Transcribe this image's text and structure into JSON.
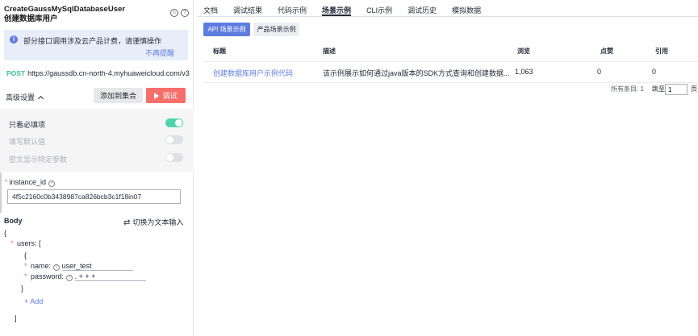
{
  "left": {
    "title": "CreateGaussMySqlDatabaseUser",
    "subtitle": "创建数据库用户",
    "notice_text": "部分接口调用涉及云产品计费，请谨慎操作",
    "notice_dismiss": "不再提醒",
    "method": "POST",
    "url": "https://gaussdb.cn-north-4.myhuaweicloud.com/v3...",
    "advanced_label": "高级设置",
    "add_to_collection": "添加到集合",
    "debug": "调试",
    "options": [
      {
        "label": "只看必填项",
        "state": "on"
      },
      {
        "label": "填写默认值",
        "state": "off"
      },
      {
        "label": "密文显示特定参数",
        "state": "off"
      }
    ],
    "instance_label": "instance_id",
    "instance_value": "4f5c2160c0b3438987ca826bcb3c1f18in07",
    "body_label": "Body",
    "switch_text": "切换为文本输入",
    "code": {
      "open_brace": "{",
      "users_key": "users: [",
      "item_open": "{",
      "name_key": "name:",
      "name_value": "user_test",
      "password_key": "password:",
      "password_value": ". + + +",
      "item_close": "}",
      "add": "+ Add",
      "array_close": "]"
    }
  },
  "tabs": [
    "文档",
    "调试结果",
    "代码示例",
    "场景示例",
    "CLI示例",
    "调试历史",
    "模拟数据"
  ],
  "active_tab_index": 3,
  "sub_buttons": {
    "primary": "API 场景示例",
    "secondary": "产品场景示例"
  },
  "table": {
    "headers": [
      "标题",
      "描述",
      "浏览",
      "点赞",
      "引用"
    ],
    "rows": [
      {
        "title": "创建数据库用户示例代码",
        "desc": "该示例展示如何通过java版本的SDK方式查询和创建数据...",
        "views": "1,063",
        "likes": "0",
        "refs": "0"
      }
    ]
  },
  "pager": {
    "total": "所有条目: 1",
    "jump": "跳至",
    "page": "1",
    "suffix": "页"
  },
  "colors": {
    "accent": "#5e7ce0",
    "danger": "#f66f6a",
    "toggle_on": "#50d4ab",
    "post": "#3ac295"
  }
}
